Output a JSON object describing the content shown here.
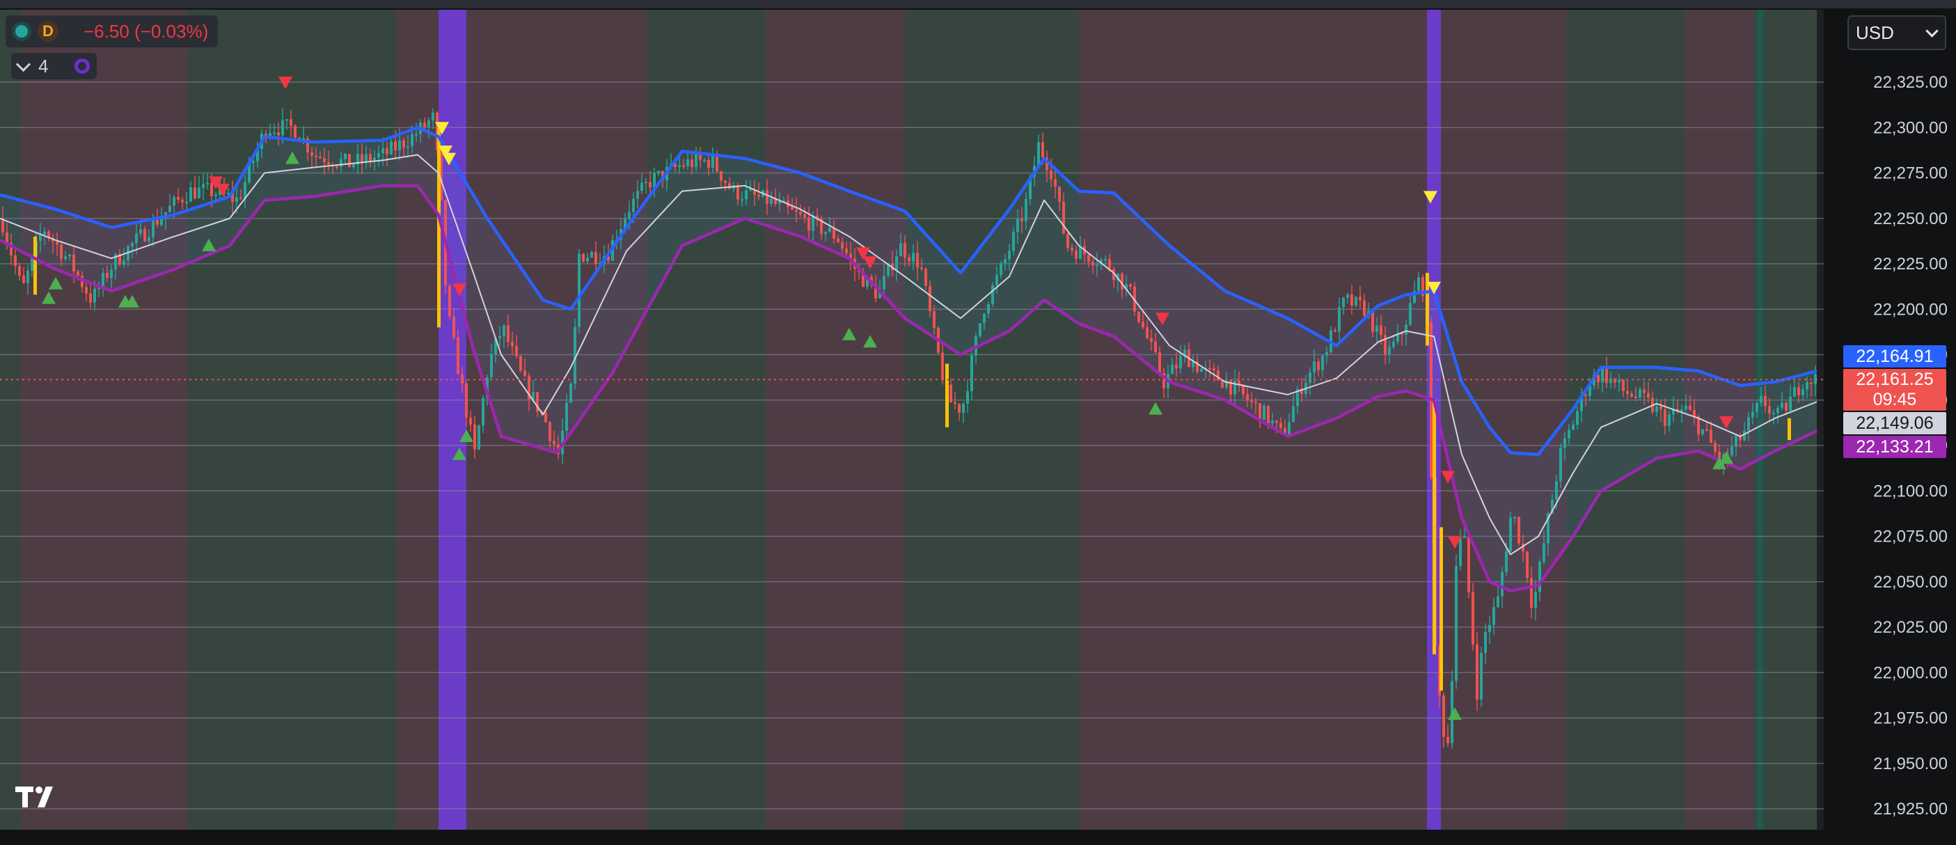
{
  "legend": {
    "interval_badge": "D",
    "change": "−6.50 (−0.03%)"
  },
  "indicators": {
    "count": "4"
  },
  "currency_selector": {
    "value": "USD"
  },
  "price_axis": {
    "ticks": [
      "22,325.00",
      "22,300.00",
      "22,275.00",
      "22,250.00",
      "22,225.00",
      "22,200.00",
      "22,175.00",
      "22,150.00",
      "22,125.00",
      "22,100.00",
      "22,075.00",
      "22,050.00",
      "22,025.00",
      "22,000.00",
      "21,975.00",
      "21,950.00",
      "21,925.00"
    ]
  },
  "price_tags": {
    "upper_band": "22,164.91",
    "last_price": "22,161.25",
    "countdown": "09:45",
    "middle_band": "22,149.06",
    "lower_band": "22,133.21"
  },
  "colors": {
    "up": "#26a69a",
    "down": "#ef5350",
    "upper_band": "#2962ff",
    "lower_band": "#9c27b0",
    "basis": "#d1d4dc",
    "session_up_bg": "#36463f",
    "session_down_bg": "#4e3c44",
    "highlight": "#6a3cc8"
  },
  "chart_data": {
    "type": "candlestick",
    "symbol_interval": "D",
    "price_range": [
      21925,
      22335
    ],
    "last_price": 22161.25,
    "sessions": [
      {
        "x": [
          0,
          0.03
        ],
        "state": "up"
      },
      {
        "x": [
          0.03,
          0.27
        ],
        "state": "down"
      },
      {
        "x": [
          0.27,
          0.57
        ],
        "state": "up"
      },
      {
        "x": [
          0.57,
          0.63
        ],
        "state": "down"
      },
      {
        "x": [
          0.63,
          0.67
        ],
        "state": "highlight"
      },
      {
        "x": [
          0.67,
          0.93
        ],
        "state": "down"
      },
      {
        "x": [
          0.93,
          1.1
        ],
        "state": "up"
      },
      {
        "x": [
          1.1,
          1.3
        ],
        "state": "down"
      },
      {
        "x": [
          1.3,
          1.55
        ],
        "state": "up"
      },
      {
        "x": [
          1.55,
          1.6
        ],
        "state": "down"
      },
      {
        "x": [
          1.6,
          2.05
        ],
        "state": "down"
      },
      {
        "x": [
          2.05,
          2.07
        ],
        "state": "highlight"
      },
      {
        "x": [
          2.07,
          2.25
        ],
        "state": "down"
      },
      {
        "x": [
          2.25,
          2.42
        ],
        "state": "up"
      },
      {
        "x": [
          2.42,
          2.52
        ],
        "state": "down"
      },
      {
        "x": [
          2.52,
          2.61
        ],
        "state": "up"
      }
    ],
    "upper_band": [
      [
        0,
        22263
      ],
      [
        0.08,
        22255
      ],
      [
        0.16,
        22245
      ],
      [
        0.25,
        22252
      ],
      [
        0.33,
        22262
      ],
      [
        0.38,
        22295
      ],
      [
        0.45,
        22292
      ],
      [
        0.55,
        22293
      ],
      [
        0.6,
        22300
      ],
      [
        0.63,
        22295
      ],
      [
        0.7,
        22250
      ],
      [
        0.78,
        22205
      ],
      [
        0.82,
        22200
      ],
      [
        0.9,
        22245
      ],
      [
        0.98,
        22287
      ],
      [
        1.07,
        22283
      ],
      [
        1.15,
        22275
      ],
      [
        1.22,
        22265
      ],
      [
        1.3,
        22254
      ],
      [
        1.38,
        22220
      ],
      [
        1.45,
        22255
      ],
      [
        1.5,
        22283
      ],
      [
        1.55,
        22265
      ],
      [
        1.6,
        22264
      ],
      [
        1.68,
        22235
      ],
      [
        1.76,
        22210
      ],
      [
        1.85,
        22195
      ],
      [
        1.92,
        22180
      ],
      [
        1.98,
        22202
      ],
      [
        2.02,
        22208
      ],
      [
        2.06,
        22210
      ],
      [
        2.1,
        22160
      ],
      [
        2.14,
        22135
      ],
      [
        2.17,
        22121
      ],
      [
        2.21,
        22120
      ],
      [
        2.26,
        22145
      ],
      [
        2.3,
        22168
      ],
      [
        2.38,
        22168
      ],
      [
        2.44,
        22166
      ],
      [
        2.5,
        22158
      ],
      [
        2.55,
        22160
      ],
      [
        2.61,
        22166
      ]
    ],
    "basis": [
      [
        0,
        22250
      ],
      [
        0.08,
        22238
      ],
      [
        0.16,
        22228
      ],
      [
        0.25,
        22240
      ],
      [
        0.33,
        22250
      ],
      [
        0.38,
        22275
      ],
      [
        0.45,
        22278
      ],
      [
        0.55,
        22282
      ],
      [
        0.6,
        22285
      ],
      [
        0.63,
        22275
      ],
      [
        0.68,
        22220
      ],
      [
        0.72,
        22175
      ],
      [
        0.78,
        22142
      ],
      [
        0.82,
        22168
      ],
      [
        0.9,
        22232
      ],
      [
        0.98,
        22265
      ],
      [
        1.07,
        22268
      ],
      [
        1.15,
        22255
      ],
      [
        1.22,
        22240
      ],
      [
        1.3,
        22218
      ],
      [
        1.38,
        22195
      ],
      [
        1.45,
        22218
      ],
      [
        1.5,
        22260
      ],
      [
        1.55,
        22235
      ],
      [
        1.6,
        22220
      ],
      [
        1.68,
        22180
      ],
      [
        1.76,
        22160
      ],
      [
        1.85,
        22153
      ],
      [
        1.92,
        22162
      ],
      [
        1.98,
        22182
      ],
      [
        2.02,
        22188
      ],
      [
        2.06,
        22185
      ],
      [
        2.1,
        22120
      ],
      [
        2.14,
        22085
      ],
      [
        2.17,
        22065
      ],
      [
        2.21,
        22075
      ],
      [
        2.26,
        22110
      ],
      [
        2.3,
        22135
      ],
      [
        2.38,
        22148
      ],
      [
        2.44,
        22140
      ],
      [
        2.5,
        22130
      ],
      [
        2.55,
        22140
      ],
      [
        2.61,
        22149
      ]
    ],
    "lower_band": [
      [
        0,
        22238
      ],
      [
        0.08,
        22222
      ],
      [
        0.16,
        22210
      ],
      [
        0.25,
        22222
      ],
      [
        0.33,
        22235
      ],
      [
        0.38,
        22260
      ],
      [
        0.45,
        22262
      ],
      [
        0.55,
        22268
      ],
      [
        0.6,
        22268
      ],
      [
        0.63,
        22252
      ],
      [
        0.68,
        22178
      ],
      [
        0.72,
        22130
      ],
      [
        0.8,
        22121
      ],
      [
        0.88,
        22165
      ],
      [
        0.98,
        22235
      ],
      [
        1.07,
        22250
      ],
      [
        1.15,
        22240
      ],
      [
        1.22,
        22228
      ],
      [
        1.3,
        22195
      ],
      [
        1.38,
        22175
      ],
      [
        1.45,
        22188
      ],
      [
        1.5,
        22205
      ],
      [
        1.55,
        22192
      ],
      [
        1.6,
        22185
      ],
      [
        1.68,
        22160
      ],
      [
        1.76,
        22150
      ],
      [
        1.85,
        22130
      ],
      [
        1.92,
        22140
      ],
      [
        1.98,
        22152
      ],
      [
        2.02,
        22155
      ],
      [
        2.06,
        22150
      ],
      [
        2.1,
        22085
      ],
      [
        2.14,
        22050
      ],
      [
        2.17,
        22045
      ],
      [
        2.21,
        22048
      ],
      [
        2.26,
        22075
      ],
      [
        2.3,
        22100
      ],
      [
        2.38,
        22118
      ],
      [
        2.44,
        22122
      ],
      [
        2.5,
        22112
      ],
      [
        2.55,
        22122
      ],
      [
        2.61,
        22133
      ]
    ],
    "price_path": [
      [
        0,
        22250
      ],
      [
        0.03,
        22210
      ],
      [
        0.06,
        22245
      ],
      [
        0.1,
        22225
      ],
      [
        0.13,
        22205
      ],
      [
        0.16,
        22225
      ],
      [
        0.2,
        22240
      ],
      [
        0.24,
        22255
      ],
      [
        0.27,
        22265
      ],
      [
        0.3,
        22265
      ],
      [
        0.34,
        22260
      ],
      [
        0.38,
        22300
      ],
      [
        0.42,
        22300
      ],
      [
        0.45,
        22285
      ],
      [
        0.5,
        22280
      ],
      [
        0.55,
        22285
      ],
      [
        0.59,
        22295
      ],
      [
        0.62,
        22305
      ],
      [
        0.63,
        22270
      ],
      [
        0.64,
        22200
      ],
      [
        0.66,
        22160
      ],
      [
        0.68,
        22120
      ],
      [
        0.7,
        22170
      ],
      [
        0.72,
        22190
      ],
      [
        0.75,
        22160
      ],
      [
        0.78,
        22140
      ],
      [
        0.8,
        22120
      ],
      [
        0.82,
        22160
      ],
      [
        0.83,
        22230
      ],
      [
        0.87,
        22230
      ],
      [
        0.9,
        22255
      ],
      [
        0.93,
        22270
      ],
      [
        0.98,
        22280
      ],
      [
        1.02,
        22282
      ],
      [
        1.05,
        22265
      ],
      [
        1.1,
        22260
      ],
      [
        1.15,
        22250
      ],
      [
        1.2,
        22240
      ],
      [
        1.23,
        22220
      ],
      [
        1.26,
        22208
      ],
      [
        1.29,
        22235
      ],
      [
        1.32,
        22225
      ],
      [
        1.34,
        22185
      ],
      [
        1.36,
        22150
      ],
      [
        1.38,
        22145
      ],
      [
        1.41,
        22200
      ],
      [
        1.44,
        22225
      ],
      [
        1.47,
        22255
      ],
      [
        1.49,
        22290
      ],
      [
        1.51,
        22275
      ],
      [
        1.53,
        22235
      ],
      [
        1.56,
        22230
      ],
      [
        1.59,
        22225
      ],
      [
        1.62,
        22210
      ],
      [
        1.65,
        22180
      ],
      [
        1.67,
        22160
      ],
      [
        1.7,
        22175
      ],
      [
        1.73,
        22165
      ],
      [
        1.76,
        22160
      ],
      [
        1.79,
        22150
      ],
      [
        1.82,
        22140
      ],
      [
        1.84,
        22130
      ],
      [
        1.87,
        22160
      ],
      [
        1.9,
        22175
      ],
      [
        1.93,
        22205
      ],
      [
        1.96,
        22200
      ],
      [
        1.99,
        22175
      ],
      [
        2.01,
        22185
      ],
      [
        2.04,
        22220
      ],
      [
        2.05,
        22180
      ],
      [
        2.06,
        22010
      ],
      [
        2.07,
        21970
      ],
      [
        2.08,
        21960
      ],
      [
        2.09,
        22060
      ],
      [
        2.1,
        22080
      ],
      [
        2.12,
        21990
      ],
      [
        2.13,
        22020
      ],
      [
        2.15,
        22040
      ],
      [
        2.17,
        22090
      ],
      [
        2.19,
        22060
      ],
      [
        2.2,
        22035
      ],
      [
        2.22,
        22080
      ],
      [
        2.24,
        22120
      ],
      [
        2.26,
        22140
      ],
      [
        2.28,
        22160
      ],
      [
        2.3,
        22165
      ],
      [
        2.33,
        22155
      ],
      [
        2.36,
        22150
      ],
      [
        2.39,
        22140
      ],
      [
        2.42,
        22145
      ],
      [
        2.45,
        22130
      ],
      [
        2.47,
        22115
      ],
      [
        2.5,
        22130
      ],
      [
        2.53,
        22150
      ],
      [
        2.55,
        22140
      ],
      [
        2.57,
        22150
      ],
      [
        2.59,
        22162
      ],
      [
        2.61,
        22161
      ]
    ],
    "signals": [
      {
        "x": 0.41,
        "price": 22325,
        "type": "sell"
      },
      {
        "x": 0.31,
        "price": 22270,
        "type": "sell"
      },
      {
        "x": 0.32,
        "price": 22266,
        "type": "sell"
      },
      {
        "x": 0.3,
        "price": 22235,
        "type": "buy"
      },
      {
        "x": 0.42,
        "price": 22283,
        "type": "buy"
      },
      {
        "x": 0.08,
        "price": 22214,
        "type": "buy"
      },
      {
        "x": 0.07,
        "price": 22206,
        "type": "buy"
      },
      {
        "x": 0.18,
        "price": 22204,
        "type": "buy"
      },
      {
        "x": 0.19,
        "price": 22204,
        "type": "buy"
      },
      {
        "x": 0.66,
        "price": 22211,
        "type": "sell"
      },
      {
        "x": 0.67,
        "price": 22130,
        "type": "buy"
      },
      {
        "x": 0.66,
        "price": 22120,
        "type": "buy"
      },
      {
        "x": 1.24,
        "price": 22231,
        "type": "sell"
      },
      {
        "x": 1.25,
        "price": 22226,
        "type": "sell"
      },
      {
        "x": 1.22,
        "price": 22186,
        "type": "buy"
      },
      {
        "x": 1.25,
        "price": 22182,
        "type": "buy"
      },
      {
        "x": 1.67,
        "price": 22195,
        "type": "sell"
      },
      {
        "x": 1.66,
        "price": 22145,
        "type": "buy"
      },
      {
        "x": 2.08,
        "price": 22108,
        "type": "sell"
      },
      {
        "x": 2.09,
        "price": 22072,
        "type": "sell"
      },
      {
        "x": 2.09,
        "price": 21977,
        "type": "buy"
      },
      {
        "x": 2.48,
        "price": 22138,
        "type": "sell"
      },
      {
        "x": 2.47,
        "price": 22115,
        "type": "buy"
      },
      {
        "x": 2.48,
        "price": 22118,
        "type": "buy"
      },
      {
        "x": 0.635,
        "price": 22300,
        "type": "alert"
      },
      {
        "x": 0.64,
        "price": 22287,
        "type": "alert"
      },
      {
        "x": 0.645,
        "price": 22283,
        "type": "alert"
      },
      {
        "x": 2.055,
        "price": 22262,
        "type": "alert"
      },
      {
        "x": 2.06,
        "price": 22212,
        "type": "alert"
      }
    ]
  }
}
